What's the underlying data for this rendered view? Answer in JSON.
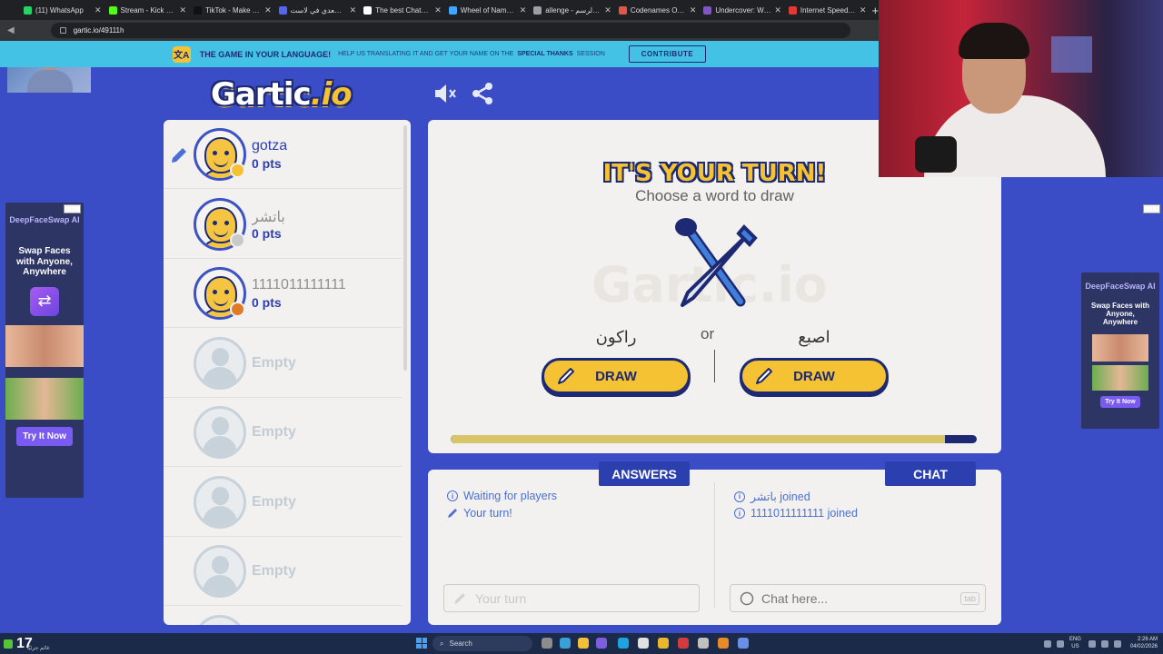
{
  "browser": {
    "tabs": [
      {
        "label": "(11) WhatsApp",
        "color": "#25d366"
      },
      {
        "label": "Stream - Kick Dashb...",
        "color": "#53fc18"
      },
      {
        "label": "TikTok - Make Your D...",
        "color": "#111111"
      },
      {
        "label": "الشيخ سعدي في لاست...",
        "color": "#5865f2"
      },
      {
        "label": "The best ChatBot an...",
        "color": "#ffffff"
      },
      {
        "label": "Wheel of Names | يا...",
        "color": "#3ea6ff"
      },
      {
        "label": "allenge - تحدي الرسم",
        "color": "#9aa0a6"
      },
      {
        "label": "Codenames Online",
        "color": "#e2564a"
      },
      {
        "label": "Undercover: Word Pa...",
        "color": "#7e57c2"
      },
      {
        "label": "Internet Speed Test |...",
        "color": "#e53935"
      }
    ],
    "url": "gartic.io/49111h"
  },
  "banner": {
    "icon": "文A",
    "title": "THE GAME IN YOUR LANGUAGE!",
    "text_before": "HELP US TRANSLATING IT AND GET YOUR NAME ON THE",
    "highlight": "SPECIAL THANKS",
    "text_after": "SESSION",
    "button": "CONTRIBUTE"
  },
  "logo": {
    "main": "Gartic",
    "suffix": ".io"
  },
  "players": [
    {
      "name": "gotza",
      "points": "0 pts",
      "status_color": "#f4c233",
      "drawing": true,
      "name_style": "blue"
    },
    {
      "name": "باتشر",
      "points": "0 pts",
      "status_color": "#c9c9c9",
      "drawing": false,
      "name_style": "gray"
    },
    {
      "name": "1111011111111",
      "points": "0 pts",
      "status_color": "#e07a24",
      "drawing": false,
      "name_style": "gray"
    }
  ],
  "empty_slots": [
    "Empty",
    "Empty",
    "Empty",
    "Empty"
  ],
  "turn": {
    "title": "IT'S YOUR TURN!",
    "subtitle": "Choose a word to draw",
    "watermark": "Gartic.io",
    "word_left": "راكون",
    "word_right": "اصبع",
    "or": "or",
    "draw_left": "DRAW",
    "draw_right": "DRAW",
    "timer_remaining": 0.94
  },
  "answers": {
    "tab": "ANSWERS",
    "messages": [
      {
        "icon": "info",
        "text": "Waiting for players"
      },
      {
        "icon": "pencil",
        "text": "Your turn!"
      }
    ],
    "placeholder": "Your turn"
  },
  "chat": {
    "tab": "CHAT",
    "messages": [
      {
        "text": "باتشر joined"
      },
      {
        "text": "1111011111111 joined"
      }
    ],
    "placeholder": "Chat here...",
    "key_hint": "tab"
  },
  "ads": {
    "left": {
      "brand": "DeepFaceSwap AI",
      "title": "Swap Faces with Anyone, Anywhere",
      "cta": "Try It Now",
      "badge": "⬚⬚"
    },
    "right": {
      "brand": "DeepFaceSwap AI",
      "title": "Swap Faces with Anyone, Anywhere",
      "cta": "Try It Now",
      "badge": "⬚⬚"
    }
  },
  "taskbar": {
    "temp": "17",
    "weather_desc": "غائم جزئيًا",
    "search": "Search",
    "lang_top": "ENG",
    "lang_bottom": "US",
    "time": "2:26 AM",
    "date": "04/02/2026"
  }
}
